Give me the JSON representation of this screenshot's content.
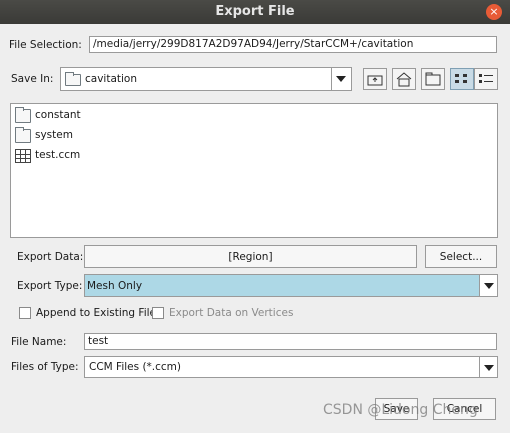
{
  "window": {
    "title": "Export File",
    "close_symbol": "×"
  },
  "file_selection": {
    "label": "File Selection:",
    "value": "/media/jerry/299D817A2D97AD94/Jerry/StarCCM+/cavitation"
  },
  "save_in": {
    "label": "Save In:",
    "value": "cavitation"
  },
  "toolbar": {
    "buttons": [
      "up-folder-icon",
      "home-icon",
      "new-folder-icon",
      "list-view-icon",
      "details-view-icon"
    ]
  },
  "file_list": [
    {
      "name": "constant",
      "icon": "folder-icon"
    },
    {
      "name": "system",
      "icon": "folder-icon"
    },
    {
      "name": "test.ccm",
      "icon": "ccm-file-icon"
    }
  ],
  "export_data": {
    "label": "Export Data:",
    "value": "[Region]",
    "select_label": "Select..."
  },
  "export_type": {
    "label": "Export Type:",
    "value": "Mesh Only",
    "highlight": "#add8e6"
  },
  "options": {
    "append_label": "Append to Existing File",
    "vertices_label": "Export Data on Vertices"
  },
  "file_name": {
    "label": "File Name:",
    "value": "test"
  },
  "files_of_type": {
    "label": "Files of Type:",
    "value": "CCM Files (*.ccm)"
  },
  "actions": {
    "save_label": "Save",
    "cancel_label": "Cancel"
  },
  "watermark": "CSDN @Lidong Cheng"
}
